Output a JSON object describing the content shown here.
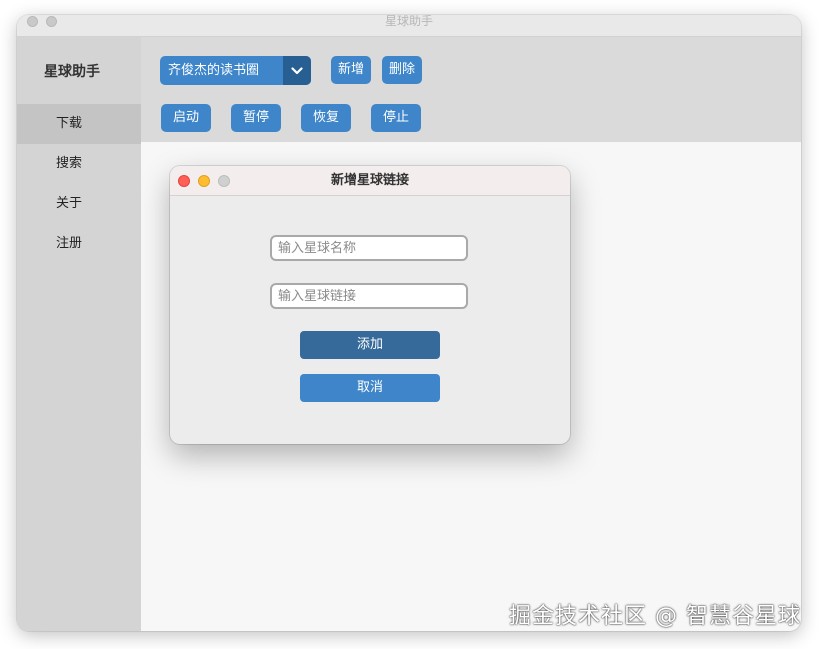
{
  "window": {
    "title": "星球助手"
  },
  "sidebar": {
    "app_name": "星球助手",
    "items": [
      {
        "label": "下载",
        "active": true
      },
      {
        "label": "搜索",
        "active": false
      },
      {
        "label": "关于",
        "active": false
      },
      {
        "label": "注册",
        "active": false
      }
    ]
  },
  "toolbar": {
    "planet_select": {
      "selected": "齐俊杰的读书圈"
    },
    "add_label": "新增",
    "delete_label": "删除",
    "start_label": "启动",
    "pause_label": "暂停",
    "resume_label": "恢复",
    "stop_label": "停止"
  },
  "dialog": {
    "title": "新增星球链接",
    "name_input": {
      "value": "",
      "placeholder": "输入星球名称"
    },
    "link_input": {
      "value": "",
      "placeholder": "输入星球链接"
    },
    "add_label": "添加",
    "cancel_label": "取消"
  },
  "watermark": "掘金技术社区 @ 智慧谷星球",
  "colors": {
    "accent": "#3e86c9",
    "accent_dark": "#285f92",
    "primary_button": "#356a9a",
    "sidebar_bg": "#d4d4d4",
    "traffic_close": "#ff5f57",
    "traffic_minimize": "#febc2e",
    "traffic_zoom_inactive": "#d0d0d0"
  },
  "icons": {
    "traffic_lights": [
      "close-icon",
      "minimize-icon",
      "zoom-icon"
    ],
    "select_arrow": "chevron-down-icon"
  }
}
